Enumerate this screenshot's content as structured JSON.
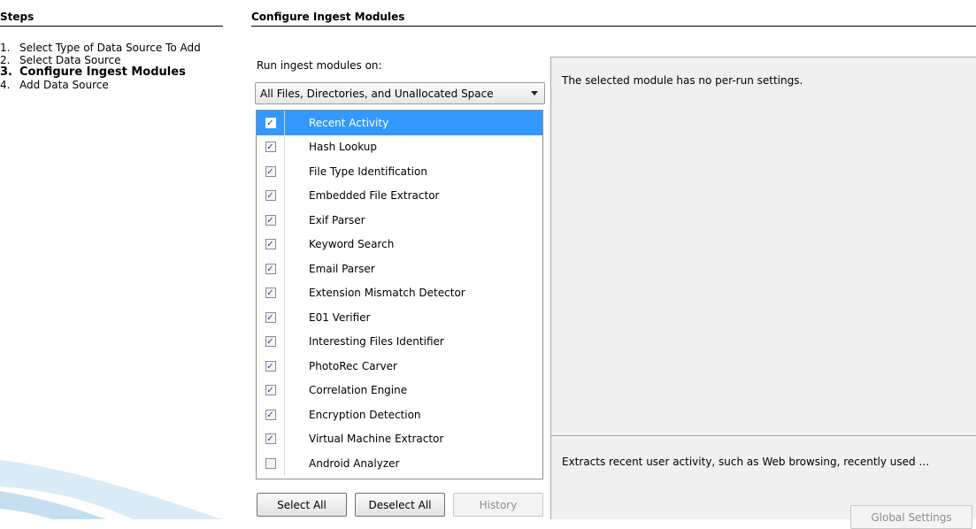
{
  "steps": {
    "title": "Steps",
    "items": [
      {
        "num": "1.",
        "label": "Select Type of Data Source To Add",
        "current": false
      },
      {
        "num": "2.",
        "label": "Select Data Source",
        "current": false
      },
      {
        "num": "3.",
        "label": "Configure Ingest Modules",
        "current": true
      },
      {
        "num": "4.",
        "label": "Add Data Source",
        "current": false
      }
    ]
  },
  "main": {
    "title": "Configure Ingest Modules",
    "run_label": "Run ingest modules on:",
    "combo_value": "All Files, Directories, and Unallocated Space",
    "modules": [
      {
        "name": "Recent Activity",
        "checked": true,
        "selected": true
      },
      {
        "name": "Hash Lookup",
        "checked": true
      },
      {
        "name": "File Type Identification",
        "checked": true
      },
      {
        "name": "Embedded File Extractor",
        "checked": true
      },
      {
        "name": "Exif Parser",
        "checked": true
      },
      {
        "name": "Keyword Search",
        "checked": true
      },
      {
        "name": "Email Parser",
        "checked": true
      },
      {
        "name": "Extension Mismatch Detector",
        "checked": true
      },
      {
        "name": "E01 Verifier",
        "checked": true
      },
      {
        "name": "Interesting Files Identifier",
        "checked": true
      },
      {
        "name": "PhotoRec Carver",
        "checked": true
      },
      {
        "name": "Correlation Engine",
        "checked": true
      },
      {
        "name": "Encryption Detection",
        "checked": true
      },
      {
        "name": "Virtual Machine Extractor",
        "checked": true
      },
      {
        "name": "Android Analyzer",
        "checked": false
      }
    ],
    "buttons": {
      "select_all": "Select All",
      "deselect_all": "Deselect All",
      "history": "History"
    },
    "settings_message": "The selected module has no per-run settings.",
    "description": "Extracts recent user activity, such as Web browsing, recently used ...",
    "global_settings": "Global Settings"
  },
  "colors": {
    "selection": "#3399ff",
    "panel": "#f0f0f0",
    "swoosh": "#cfe4f4"
  }
}
